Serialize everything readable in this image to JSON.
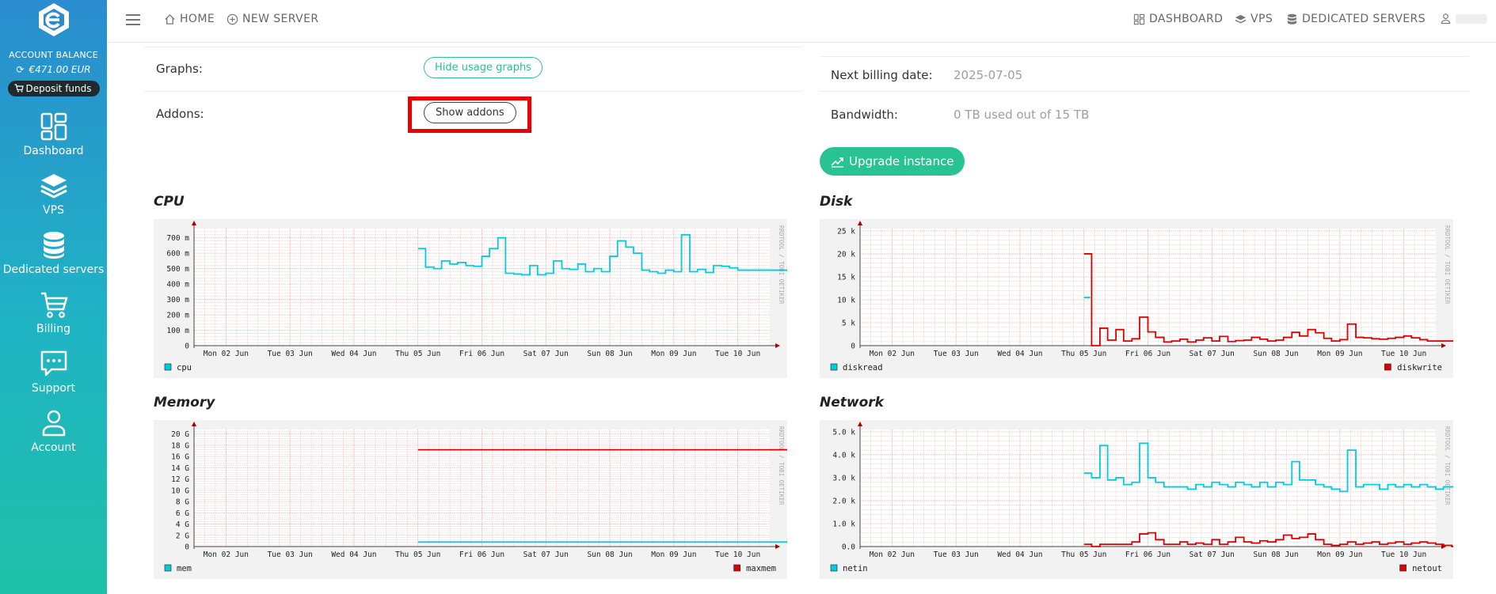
{
  "sidebar": {
    "account_label": "ACCOUNT BALANCE",
    "balance": "€471.00 EUR",
    "deposit_label": "Deposit funds",
    "items": [
      {
        "label": "Dashboard",
        "icon": "dashboard-icon"
      },
      {
        "label": "VPS",
        "icon": "layers-icon"
      },
      {
        "label": "Dedicated servers",
        "icon": "database-icon"
      },
      {
        "label": "Billing",
        "icon": "cart-icon"
      },
      {
        "label": "Support",
        "icon": "chat-icon"
      },
      {
        "label": "Account",
        "icon": "user-icon"
      }
    ]
  },
  "topbar": {
    "home": "HOME",
    "new_server": "NEW SERVER",
    "dashboard": "DASHBOARD",
    "vps": "VPS",
    "dedicated": "DEDICATED SERVERS"
  },
  "details": {
    "graphs_label": "Graphs:",
    "graphs_button": "Hide usage graphs",
    "addons_label": "Addons:",
    "addons_button": "Show addons",
    "billing_label": "Next billing date:",
    "billing_value": "2025-07-05",
    "bandwidth_label": "Bandwidth:",
    "bandwidth_value": "0 TB used out of 15 TB",
    "upgrade_label": "Upgrade instance"
  },
  "colors": {
    "accent_green": "#28c391",
    "series_cyan": "#00ccdd",
    "series_red": "#dd0000",
    "highlight": "#ee0000"
  },
  "chart_data": [
    {
      "type": "line",
      "title": "CPU",
      "watermark": "RRDTOOL / TOBI OETIKER",
      "x_ticks": [
        "Mon 02 Jun",
        "Tue 03 Jun",
        "Wed 04 Jun",
        "Thu 05 Jun",
        "Fri 06 Jun",
        "Sat 07 Jun",
        "Sun 08 Jun",
        "Mon 09 Jun",
        "Tue 10 Jun"
      ],
      "y_ticks": [
        "0",
        "100 m",
        "200 m",
        "300 m",
        "400 m",
        "500 m",
        "600 m",
        "700 m"
      ],
      "ylim": [
        0,
        760
      ],
      "series": [
        {
          "name": "cpu",
          "color": "#00ccdd",
          "x": [
            3.0,
            3.12,
            3.25,
            3.37,
            3.5,
            3.62,
            3.75,
            3.87,
            4.0,
            4.12,
            4.25,
            4.37,
            4.5,
            4.62,
            4.75,
            4.87,
            5.0,
            5.12,
            5.25,
            5.37,
            5.5,
            5.62,
            5.75,
            5.87,
            6.0,
            6.12,
            6.25,
            6.37,
            6.5,
            6.62,
            6.75,
            6.87,
            7.0,
            7.12,
            7.25,
            7.37,
            7.5,
            7.62,
            7.75,
            7.87,
            8.0,
            8.12,
            8.25,
            8.37,
            8.5,
            8.62,
            8.75,
            8.87
          ],
          "values": [
            630,
            510,
            500,
            550,
            530,
            540,
            520,
            515,
            580,
            630,
            700,
            470,
            465,
            460,
            520,
            460,
            470,
            550,
            500,
            495,
            530,
            480,
            500,
            480,
            580,
            680,
            640,
            600,
            490,
            480,
            470,
            490,
            480,
            720,
            480,
            495,
            475,
            520,
            515,
            505,
            490,
            490,
            490,
            490,
            490,
            490,
            490,
            490
          ]
        }
      ],
      "legend": [
        {
          "name": "cpu",
          "color": "#00ccdd",
          "position": "left"
        }
      ]
    },
    {
      "type": "line",
      "title": "Disk",
      "watermark": "RRDTOOL / TOBI OETIKER",
      "x_ticks": [
        "Mon 02 Jun",
        "Tue 03 Jun",
        "Wed 04 Jun",
        "Thu 05 Jun",
        "Fri 06 Jun",
        "Sat 07 Jun",
        "Sun 08 Jun",
        "Mon 09 Jun",
        "Tue 10 Jun"
      ],
      "y_ticks": [
        "0",
        "5 k",
        "10 k",
        "15 k",
        "20 k",
        "25 k"
      ],
      "ylim": [
        0,
        25500
      ],
      "series": [
        {
          "name": "diskread",
          "color": "#00ccdd",
          "x": [
            3.0,
            3.1
          ],
          "values": [
            10500,
            10500
          ]
        },
        {
          "name": "diskwrite",
          "color": "#dd0000",
          "x": [
            3.0,
            3.12,
            3.25,
            3.37,
            3.5,
            3.62,
            3.75,
            3.87,
            4.0,
            4.12,
            4.25,
            4.37,
            4.5,
            4.62,
            4.75,
            4.87,
            5.0,
            5.12,
            5.25,
            5.37,
            5.5,
            5.62,
            5.75,
            5.87,
            6.0,
            6.12,
            6.25,
            6.37,
            6.5,
            6.62,
            6.75,
            6.87,
            7.0,
            7.12,
            7.25,
            7.37,
            7.5,
            7.62,
            7.75,
            7.87,
            8.0,
            8.12,
            8.25,
            8.37,
            8.5,
            8.62,
            8.75,
            8.87
          ],
          "values": [
            20000,
            0,
            3800,
            1200,
            3500,
            1000,
            1500,
            6200,
            3000,
            1800,
            800,
            1000,
            1400,
            800,
            1200,
            1700,
            1000,
            2000,
            900,
            1100,
            1200,
            1800,
            1400,
            1000,
            1200,
            1800,
            2900,
            2100,
            3500,
            2800,
            1600,
            1000,
            1300,
            4700,
            1800,
            1700,
            1500,
            1400,
            1600,
            1800,
            2100,
            1700,
            1300,
            1000,
            1000,
            1000,
            1000,
            1000
          ]
        }
      ],
      "legend": [
        {
          "name": "diskread",
          "color": "#00ccdd",
          "position": "left"
        },
        {
          "name": "diskwrite",
          "color": "#dd0000",
          "position": "right"
        }
      ]
    },
    {
      "type": "line",
      "title": "Memory",
      "watermark": "RRDTOOL / TOBI OETIKER",
      "x_ticks": [
        "Mon 02 Jun",
        "Tue 03 Jun",
        "Wed 04 Jun",
        "Thu 05 Jun",
        "Fri 06 Jun",
        "Sat 07 Jun",
        "Sun 08 Jun",
        "Mon 09 Jun",
        "Tue 10 Jun"
      ],
      "y_ticks": [
        "0",
        "2 G",
        "4 G",
        "6 G",
        "8 G",
        "10 G",
        "12 G",
        "14 G",
        "16 G",
        "18 G",
        "20 G"
      ],
      "ylim": [
        0,
        20.8
      ],
      "series": [
        {
          "name": "mem",
          "color": "#00ccdd",
          "x": [
            3.0,
            8.87
          ],
          "values": [
            0.8,
            0.8
          ]
        },
        {
          "name": "maxmem",
          "color": "#dd0000",
          "x": [
            3.0,
            8.87
          ],
          "values": [
            17.2,
            17.2
          ]
        }
      ],
      "legend": [
        {
          "name": "mem",
          "color": "#00ccdd",
          "position": "left"
        },
        {
          "name": "maxmem",
          "color": "#dd0000",
          "position": "right"
        }
      ]
    },
    {
      "type": "line",
      "title": "Network",
      "watermark": "RRDTOOL / TOBI OETIKER",
      "x_ticks": [
        "Mon 02 Jun",
        "Tue 03 Jun",
        "Wed 04 Jun",
        "Thu 05 Jun",
        "Fri 06 Jun",
        "Sat 07 Jun",
        "Sun 08 Jun",
        "Mon 09 Jun",
        "Tue 10 Jun"
      ],
      "y_ticks": [
        "0.0",
        "1.0 k",
        "2.0 k",
        "3.0 k",
        "4.0 k",
        "5.0 k"
      ],
      "ylim": [
        0,
        5100
      ],
      "series": [
        {
          "name": "netin",
          "color": "#00ccdd",
          "x": [
            3.0,
            3.12,
            3.25,
            3.37,
            3.5,
            3.62,
            3.75,
            3.87,
            4.0,
            4.12,
            4.25,
            4.37,
            4.5,
            4.62,
            4.75,
            4.87,
            5.0,
            5.12,
            5.25,
            5.37,
            5.5,
            5.62,
            5.75,
            5.87,
            6.0,
            6.12,
            6.25,
            6.37,
            6.5,
            6.62,
            6.75,
            6.87,
            7.0,
            7.12,
            7.25,
            7.37,
            7.5,
            7.62,
            7.75,
            7.87,
            8.0,
            8.12,
            8.25,
            8.37,
            8.5,
            8.62,
            8.75,
            8.87
          ],
          "values": [
            3200,
            3000,
            4400,
            2900,
            3000,
            2700,
            2800,
            4500,
            3000,
            2800,
            2600,
            2600,
            2600,
            2500,
            2700,
            2600,
            2800,
            2700,
            2600,
            2800,
            2700,
            2600,
            2800,
            2600,
            2800,
            2700,
            3700,
            2900,
            2900,
            2700,
            2600,
            2500,
            2400,
            4200,
            2600,
            2700,
            2700,
            2500,
            2700,
            2600,
            2700,
            2600,
            2700,
            2600,
            2500,
            2600,
            2600,
            2600
          ]
        },
        {
          "name": "netout",
          "color": "#dd0000",
          "x": [
            3.0,
            3.12,
            3.25,
            3.37,
            3.5,
            3.62,
            3.75,
            3.87,
            4.0,
            4.12,
            4.25,
            4.37,
            4.5,
            4.62,
            4.75,
            4.87,
            5.0,
            5.12,
            5.25,
            5.37,
            5.5,
            5.62,
            5.75,
            5.87,
            6.0,
            6.12,
            6.25,
            6.37,
            6.5,
            6.62,
            6.75,
            6.87,
            7.0,
            7.12,
            7.25,
            7.37,
            7.5,
            7.62,
            7.75,
            7.87,
            8.0,
            8.12,
            8.25,
            8.37,
            8.5,
            8.62,
            8.75,
            8.87
          ],
          "values": [
            100,
            0,
            100,
            100,
            100,
            100,
            200,
            550,
            600,
            300,
            100,
            100,
            200,
            100,
            150,
            100,
            300,
            100,
            200,
            400,
            200,
            150,
            250,
            200,
            300,
            500,
            350,
            400,
            550,
            300,
            100,
            50,
            100,
            200,
            100,
            150,
            200,
            100,
            150,
            200,
            100,
            150,
            200,
            150,
            100,
            50,
            0,
            0
          ]
        }
      ],
      "legend": [
        {
          "name": "netin",
          "color": "#00ccdd",
          "position": "left"
        },
        {
          "name": "netout",
          "color": "#dd0000",
          "position": "right"
        }
      ]
    }
  ]
}
